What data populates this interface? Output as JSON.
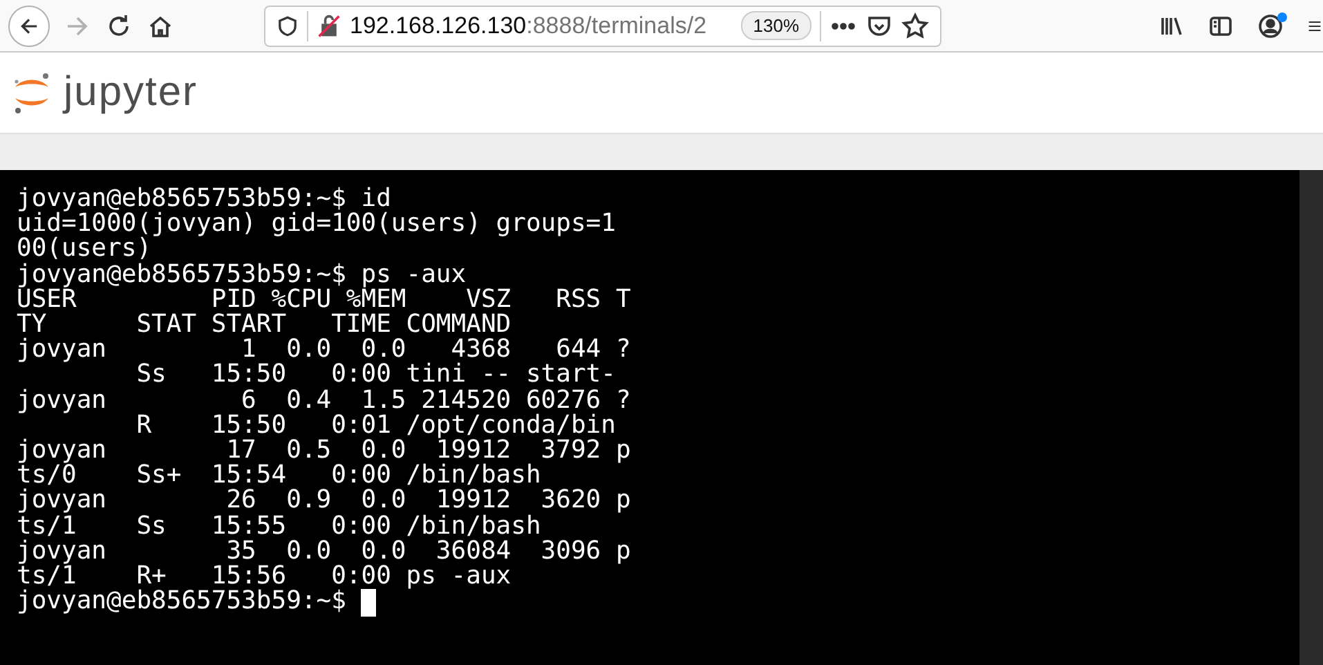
{
  "browser": {
    "url_host": "192.168.126.130",
    "url_path": ":8888/terminals/2",
    "zoom": "130%",
    "forward_disabled": true,
    "account_notification": true
  },
  "header": {
    "logo_text": "jupyter"
  },
  "terminal": {
    "lines": [
      "jovyan@eb8565753b59:~$ id",
      "uid=1000(jovyan) gid=100(users) groups=1",
      "00(users)",
      "jovyan@eb8565753b59:~$ ps -aux",
      "USER         PID %CPU %MEM    VSZ   RSS T",
      "TY      STAT START   TIME COMMAND",
      "jovyan         1  0.0  0.0   4368   644 ?",
      "        Ss   15:50   0:00 tini -- start-",
      "jovyan         6  0.4  1.5 214520 60276 ?",
      "        R    15:50   0:01 /opt/conda/bin",
      "jovyan        17  0.5  0.0  19912  3792 p",
      "ts/0    Ss+  15:54   0:00 /bin/bash",
      "jovyan        26  0.9  0.0  19912  3620 p",
      "ts/1    Ss   15:55   0:00 /bin/bash",
      "jovyan        35  0.0  0.0  36084  3096 p",
      "ts/1    R+   15:56   0:00 ps -aux"
    ],
    "prompt": "jovyan@eb8565753b59:~$ "
  }
}
